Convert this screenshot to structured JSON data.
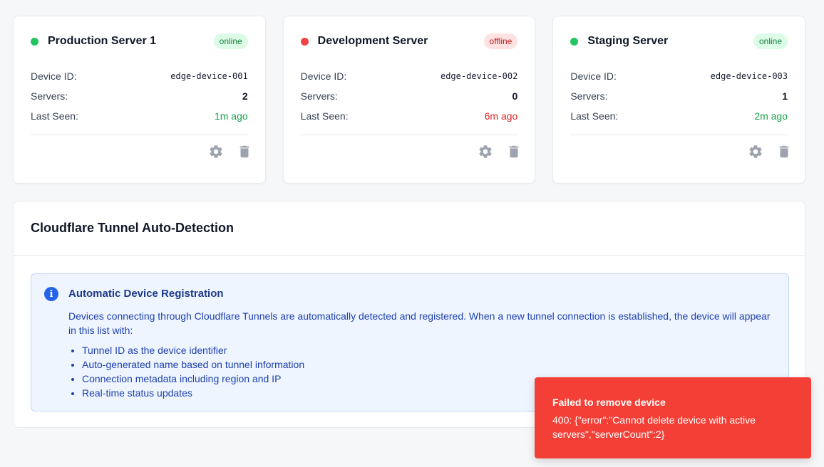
{
  "devices": [
    {
      "name": "Production Server 1",
      "status": "online",
      "device_id_label": "Device ID:",
      "device_id": "edge-device-001",
      "servers_label": "Servers:",
      "servers": "2",
      "last_seen_label": "Last Seen:",
      "last_seen": "1m ago"
    },
    {
      "name": "Development Server",
      "status": "offline",
      "device_id_label": "Device ID:",
      "device_id": "edge-device-002",
      "servers_label": "Servers:",
      "servers": "0",
      "last_seen_label": "Last Seen:",
      "last_seen": "6m ago"
    },
    {
      "name": "Staging Server",
      "status": "online",
      "device_id_label": "Device ID:",
      "device_id": "edge-device-003",
      "servers_label": "Servers:",
      "servers": "1",
      "last_seen_label": "Last Seen:",
      "last_seen": "2m ago"
    }
  ],
  "icons": {
    "settings": "gear-icon",
    "delete": "trash-icon",
    "info": "info-icon"
  },
  "colors": {
    "online": "#22c55e",
    "offline": "#ef4444",
    "toast": "#f43f36",
    "info_bg": "#eef5ff"
  },
  "tunnel_panel": {
    "title": "Cloudflare Tunnel Auto-Detection",
    "info_title": "Automatic Device Registration",
    "info_text": "Devices connecting through Cloudflare Tunnels are automatically detected and registered. When a new tunnel connection is established, the device will appear in this list with:",
    "items": [
      "Tunnel ID as the device identifier",
      "Auto-generated name based on tunnel information",
      "Connection metadata including region and IP",
      "Real-time status updates"
    ]
  },
  "toast": {
    "title": "Failed to remove device",
    "message": "400: {\"error\":\"Cannot delete device with active servers\",\"serverCount\":2}"
  }
}
